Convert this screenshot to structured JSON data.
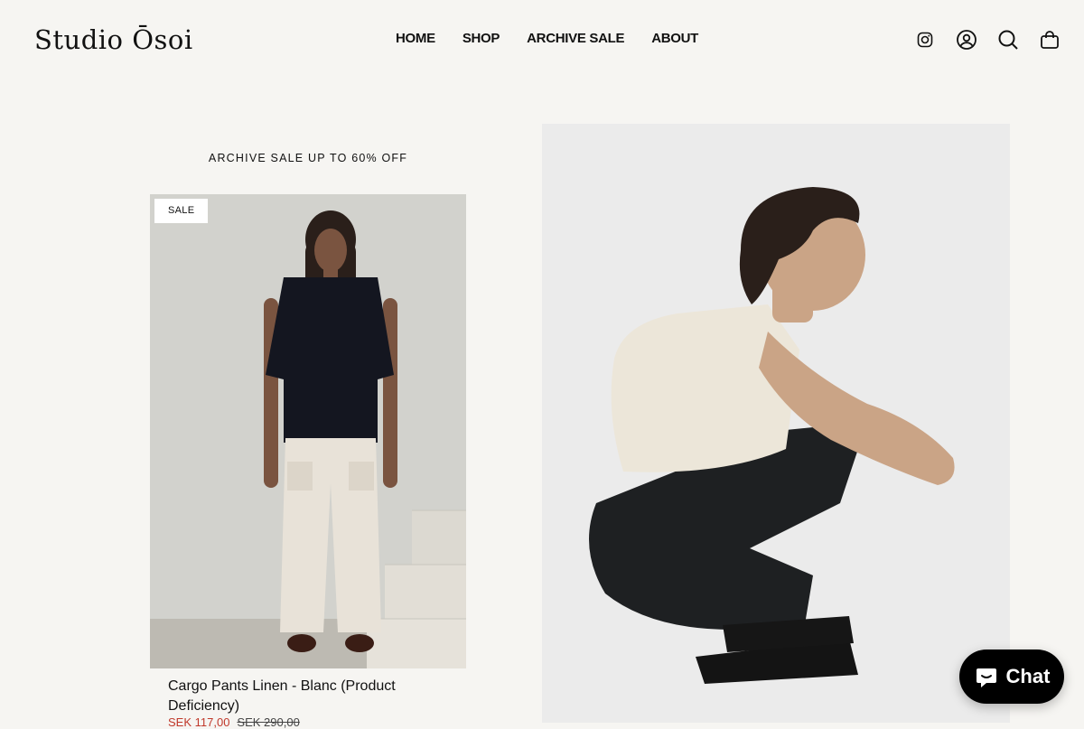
{
  "brand": {
    "name": "Studio Ōsoi"
  },
  "nav": {
    "items": [
      {
        "label": "HOME"
      },
      {
        "label": "SHOP"
      },
      {
        "label": "ARCHIVE SALE"
      },
      {
        "label": "ABOUT"
      }
    ]
  },
  "header_icons": [
    "instagram-icon",
    "account-icon",
    "search-icon",
    "cart-icon"
  ],
  "promo": {
    "text": "ARCHIVE SALE UP TO 60% OFF"
  },
  "product": {
    "badge": "SALE",
    "title": "Cargo Pants Linen - Blanc (Product Deficiency)",
    "price_sale": "SEK 117,00",
    "price_regular": "SEK 290,00",
    "sale_color": "#c0392b"
  },
  "chat": {
    "label": "Chat",
    "background": "#000000"
  }
}
